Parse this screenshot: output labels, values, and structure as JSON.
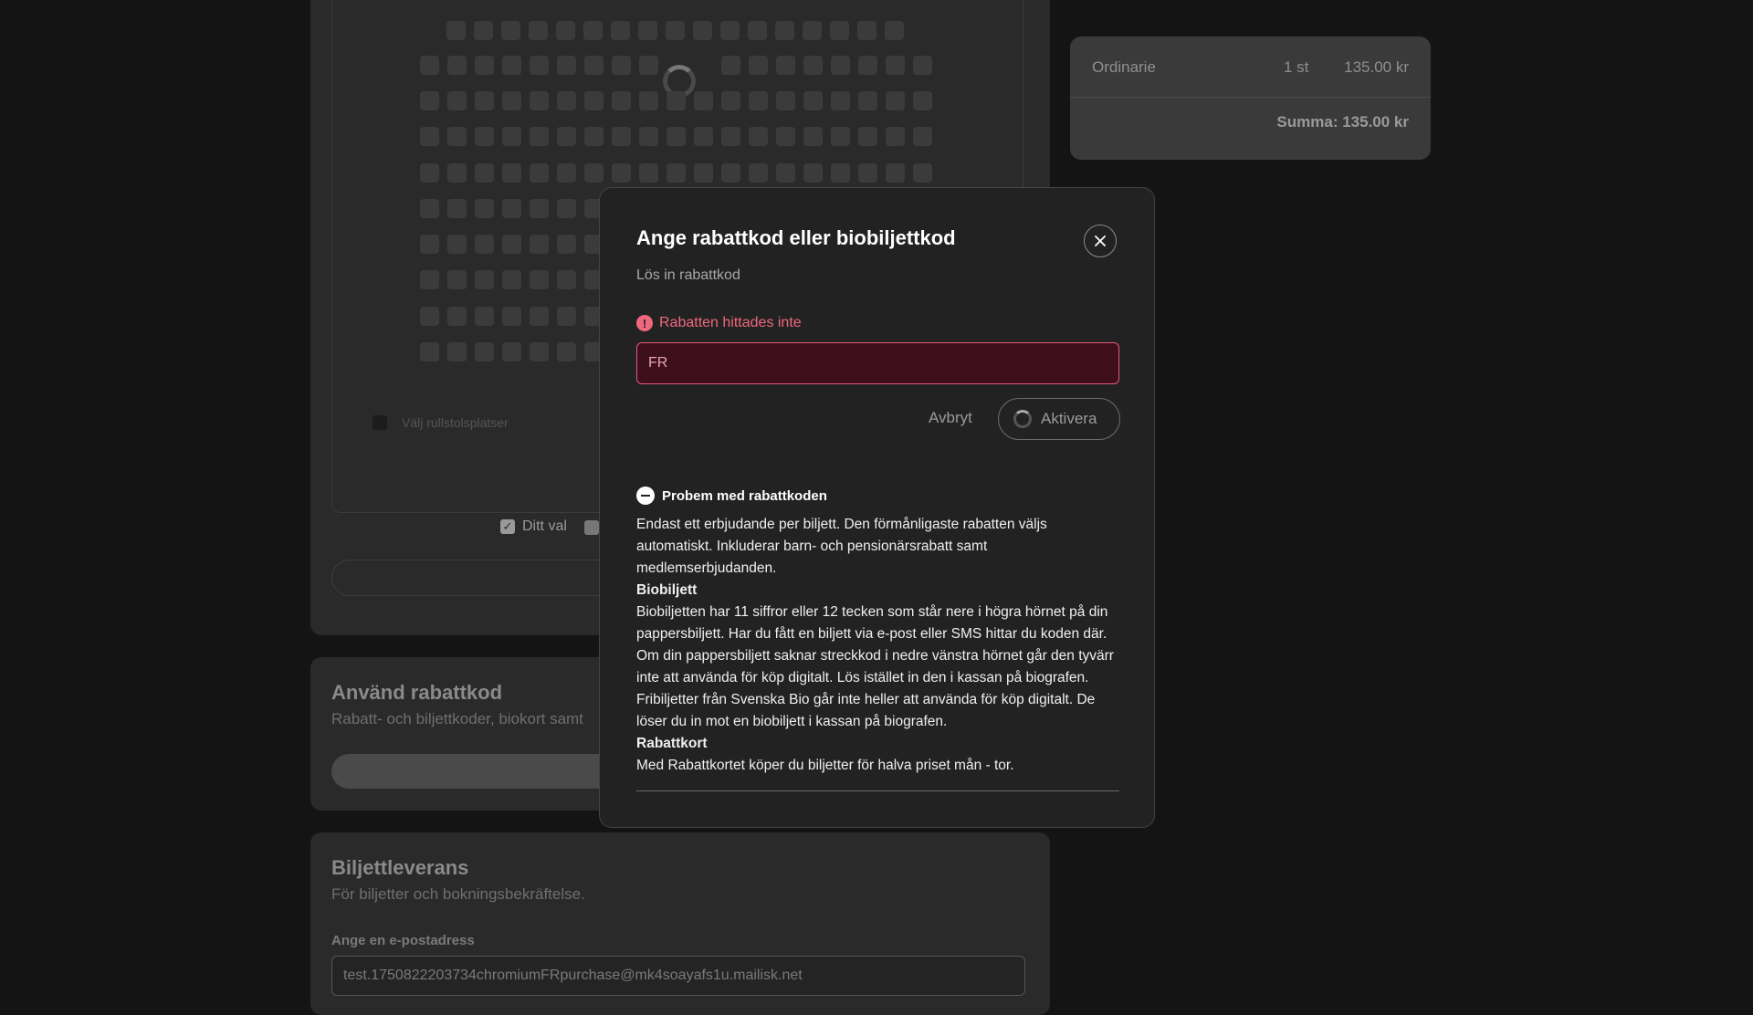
{
  "seatmap": {
    "legend_selected": "Ditt val",
    "wheelchair_label": "Välj rullstolsplatser"
  },
  "discount_section": {
    "title": "Använd rabattkod",
    "subtitle": "Rabatt- och biljettkoder, biokort samt"
  },
  "delivery_section": {
    "title": "Biljettleverans",
    "subtitle": "För biljetter och bokningsbekräftelse.",
    "email_label": "Ange en e-postadress",
    "email_value": "test.1750822203734chromiumFRpurchase@mk4soayafs1u.mailisk.net"
  },
  "summary": {
    "ticket_type": "Ordinarie",
    "quantity": "1 st",
    "price": "135.00 kr",
    "total": "Summa: 135.00 kr"
  },
  "modal": {
    "title": "Ange rabattkod eller biobiljettkod",
    "subtitle": "Lös in rabattkod",
    "error": "Rabatten hittades inte",
    "error_icon": "!",
    "code_value": "FR",
    "cancel_label": "Avbryt",
    "activate_label": "Aktivera",
    "info_title": "Probem med rabattkoden",
    "info_intro": "Endast ett erbjudande per biljett. Den förmånligaste rabatten väljs automatiskt. Inkluderar barn- och pensionärsrabatt samt medlemserbjudanden.",
    "biobiljett_title": "Biobiljett",
    "biobiljett_text": "Biobiljetten har 11 siffror eller 12 tecken som står nere i högra hörnet på din pappersbiljett. Har du fått en biljett via e-post eller SMS hittar du koden där. Om din pappersbiljett saknar streckkod i nedre vänstra hörnet går den tyvärr inte att använda för köp digitalt. Lös istället in den i kassan på biografen. Fribiljetter från Svenska Bio går inte heller att använda för köp digitalt. De löser du in mot en biobiljett i kassan på biografen.",
    "rabattkort_title": "Rabattkort",
    "rabattkort_text": "Med Rabattkortet köper du biljetter för halva priset mån - tor."
  },
  "icons": {
    "close": "close-icon",
    "error": "alert-circle-icon",
    "collapse": "minus-circle-icon",
    "loading": "spinner-icon"
  },
  "colors": {
    "error": "#f0687e",
    "error_input_bg": "#3d0f1c",
    "modal_bg": "#222222",
    "seat_selected": "#2f5fae"
  }
}
